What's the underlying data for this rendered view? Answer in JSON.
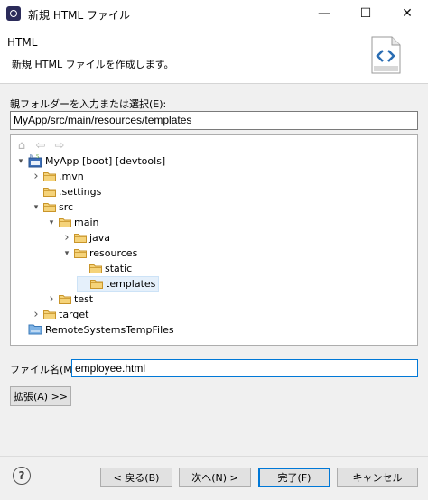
{
  "window": {
    "title": "新規 HTML ファイル",
    "min_glyph": "—",
    "max_glyph": "☐",
    "close_glyph": "✕"
  },
  "banner": {
    "title": "HTML",
    "description": "新規 HTML ファイルを作成します。"
  },
  "parent_folder": {
    "label": "親フォルダーを入力または選択(E):",
    "value": "MyApp/src/main/resources/templates"
  },
  "tree": {
    "toolbar": {
      "home": "⌂",
      "back": "⇦",
      "forward": "⇨"
    },
    "items": [
      {
        "label": "MyApp [boot] [devtools]",
        "kind": "project",
        "expanded": true
      },
      {
        "label": ".mvn",
        "kind": "folder",
        "expanded": false
      },
      {
        "label": ".settings",
        "kind": "folder",
        "expanded": null
      },
      {
        "label": "src",
        "kind": "folder",
        "expanded": true
      },
      {
        "label": "main",
        "kind": "folder",
        "expanded": true
      },
      {
        "label": "java",
        "kind": "folder",
        "expanded": false
      },
      {
        "label": "resources",
        "kind": "folder",
        "expanded": true
      },
      {
        "label": "static",
        "kind": "folder",
        "expanded": null
      },
      {
        "label": "templates",
        "kind": "folder",
        "expanded": null,
        "selected": true
      },
      {
        "label": "test",
        "kind": "folder",
        "expanded": false
      },
      {
        "label": "target",
        "kind": "folder",
        "expanded": false
      },
      {
        "label": "RemoteSystemsTempFiles",
        "kind": "remote",
        "expanded": null
      }
    ]
  },
  "file_name": {
    "label": "ファイル名(M):",
    "value": "employee.html"
  },
  "buttons": {
    "expand": "拡張(A) >>",
    "back": "< 戻る(B)",
    "next": "次へ(N) >",
    "finish": "完了(F)",
    "cancel": "キャンセル"
  },
  "help_glyph": "?",
  "colors": {
    "accent": "#0078d7",
    "folder": "#e8b84a",
    "selected_bg": "#e5f0fb"
  }
}
